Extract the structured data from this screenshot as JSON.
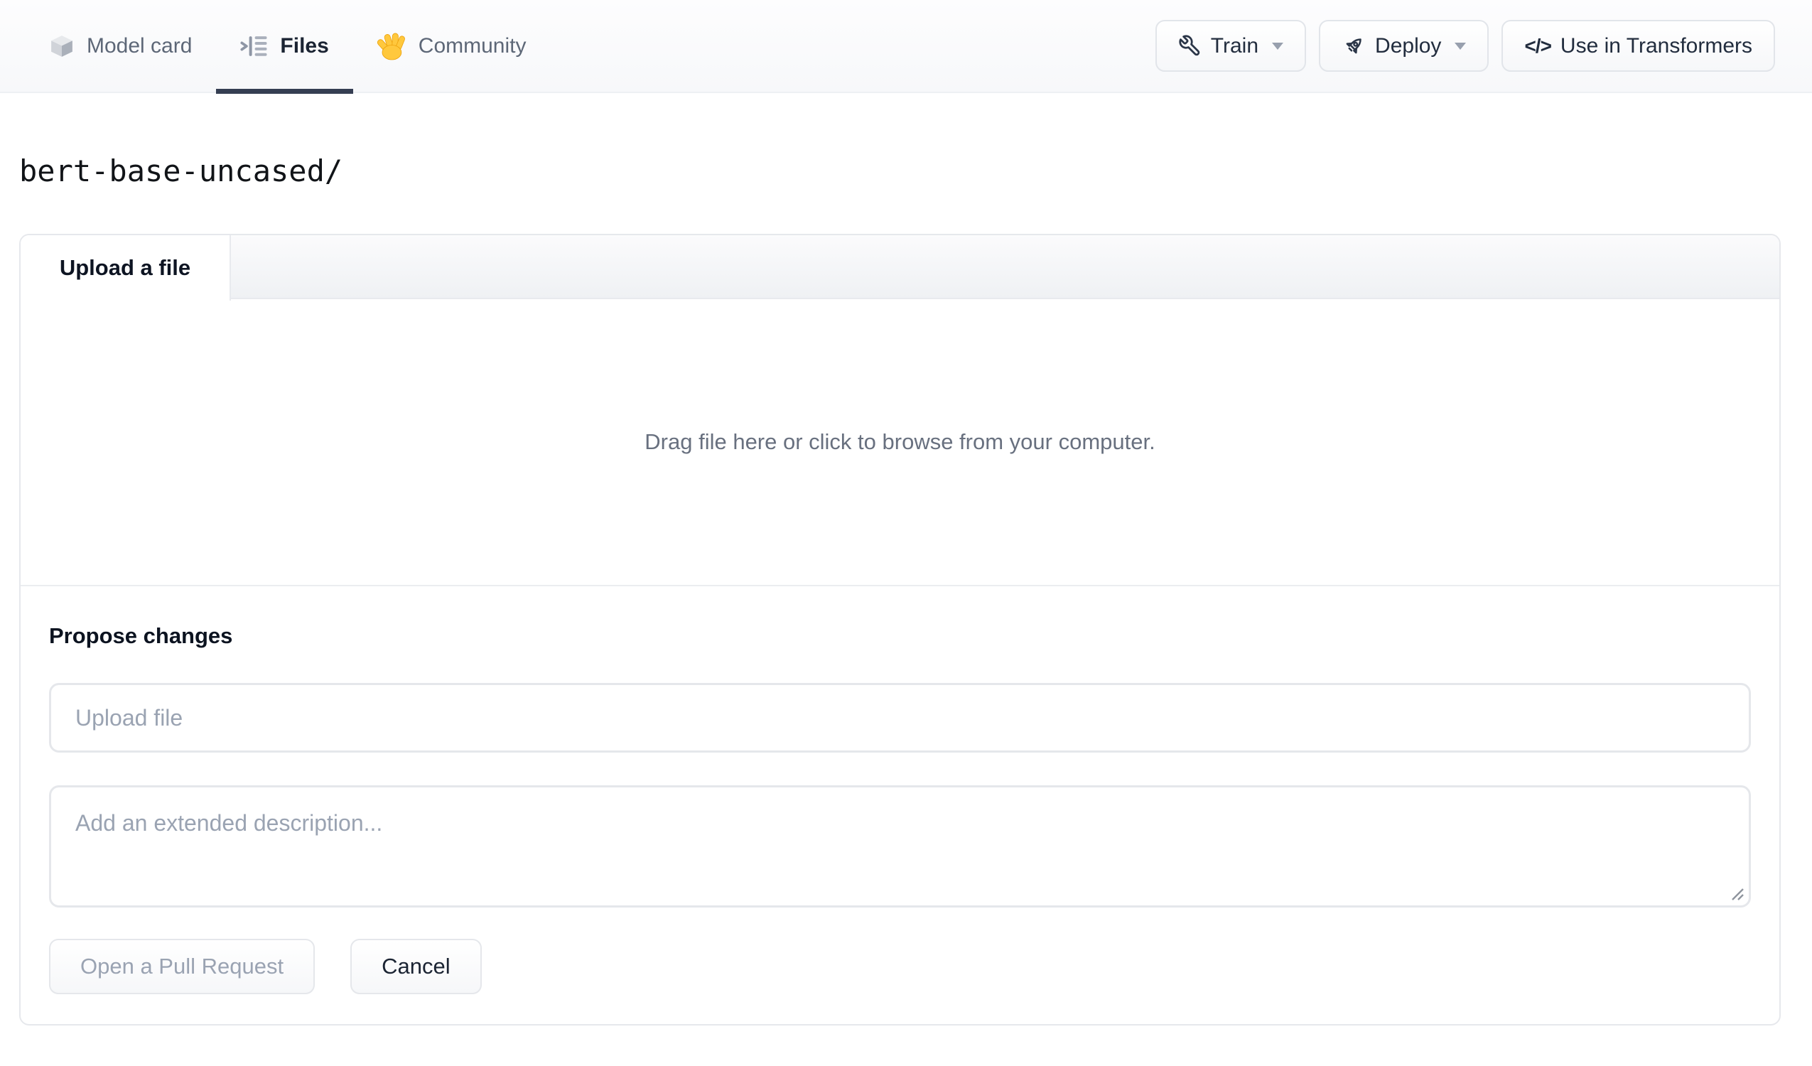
{
  "nav": {
    "tabs": [
      {
        "label": "Model card"
      },
      {
        "label": "Files"
      },
      {
        "label": "Community"
      }
    ],
    "actions": {
      "train": "Train",
      "deploy": "Deploy",
      "use_in_transformers": "Use in Transformers"
    }
  },
  "icons": {
    "code_glyph": "</>"
  },
  "breadcrumb": {
    "path": "bert-base-uncased/"
  },
  "upload_panel": {
    "tab_label": "Upload a file",
    "dropzone_text": "Drag file here or click to browse from your computer.",
    "propose_heading": "Propose changes",
    "filename_placeholder": "Upload file",
    "description_placeholder": "Add an extended description...",
    "open_pr_label": "Open a Pull Request",
    "cancel_label": "Cancel"
  },
  "colors": {
    "active_tab_indicator": "#353e52",
    "card_border": "#e6e8ec",
    "field_border": "#e5e7eb",
    "muted_text": "#68707f",
    "placeholder_text": "#9aa3b2",
    "emoji_hand": "#ffc83d"
  }
}
